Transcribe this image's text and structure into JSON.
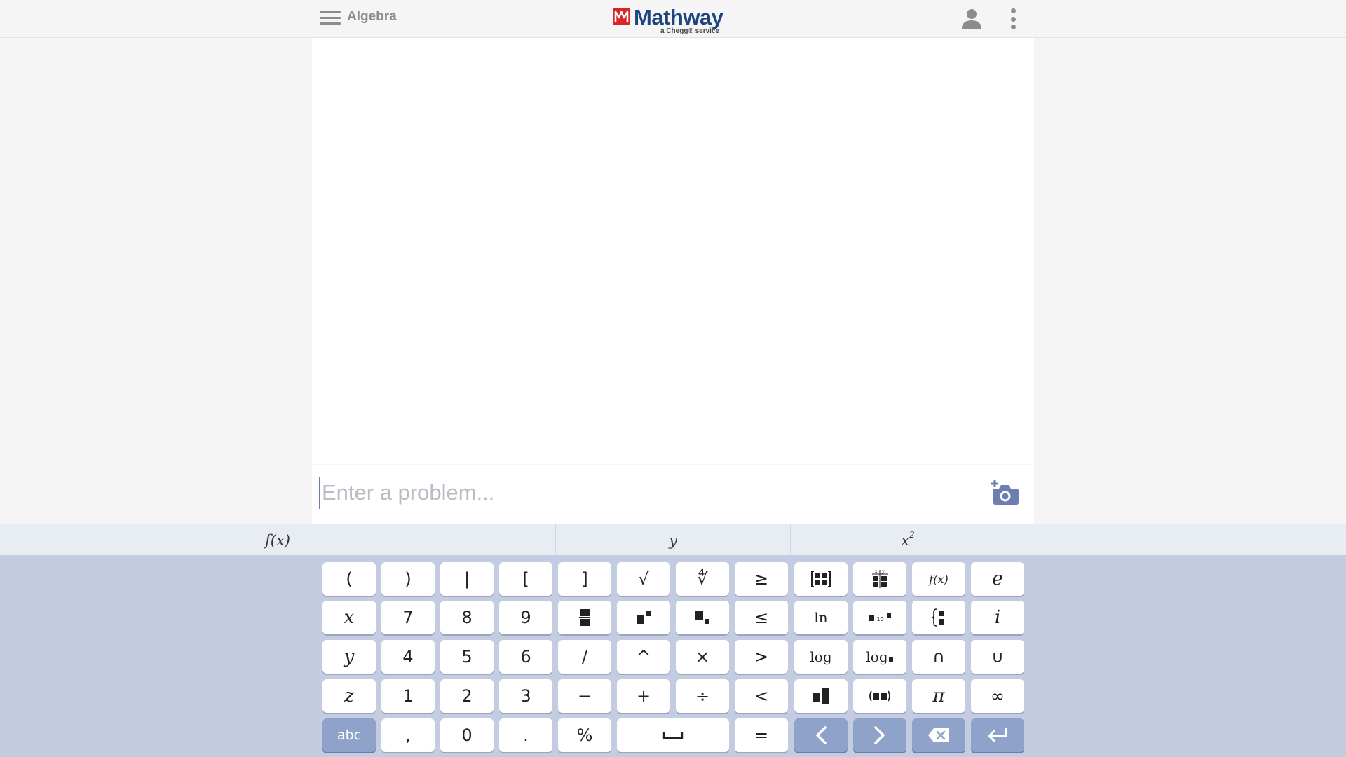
{
  "header": {
    "subject": "Algebra",
    "logo_text": "Mathway",
    "logo_sub": "a Chegg® service",
    "brand_color": "#1d4680",
    "logo_mark_color": "#d8262a"
  },
  "input": {
    "placeholder": "Enter a problem..."
  },
  "keyboard_tabs": [
    {
      "label": "f(x)"
    },
    {
      "label": "y"
    },
    {
      "label": "x",
      "sup": "2"
    }
  ],
  "keys": {
    "lparen": "(",
    "rparen": ")",
    "abs": "|",
    "lbracket": "[",
    "rbracket": "]",
    "sqrt": "√",
    "nthroot": "∜",
    "gte": "≥",
    "fx": "f(x)",
    "e": "e",
    "x": "x",
    "seven": "7",
    "eight": "8",
    "nine": "9",
    "lte": "≤",
    "ln": "ln",
    "i": "i",
    "y": "y",
    "four": "4",
    "five": "5",
    "six": "6",
    "slash": "/",
    "caret": "^",
    "times": "×",
    "gt": ">",
    "log": "log",
    "logb": "log",
    "intersect": "∩",
    "union": "∪",
    "z": "z",
    "one": "1",
    "two": "2",
    "three": "3",
    "minus": "−",
    "plus": "+",
    "divide": "÷",
    "lt": "<",
    "pi": "π",
    "infinity": "∞",
    "abc": "abc",
    "comma": ",",
    "zero": "0",
    "dot": ".",
    "percent": "%",
    "equals": "="
  },
  "colors": {
    "keypad_bg": "#c3cce0",
    "key_dark": "#8fa2c9"
  }
}
